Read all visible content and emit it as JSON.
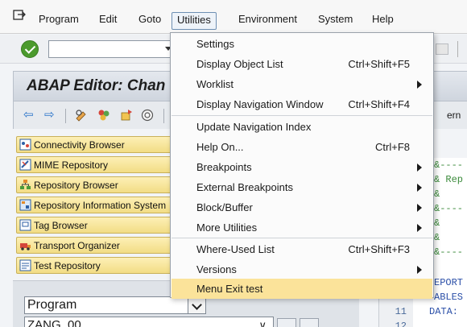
{
  "menubar": {
    "items": [
      {
        "label": "Program"
      },
      {
        "label": "Edit"
      },
      {
        "label": "Goto"
      },
      {
        "label": "Utilities"
      },
      {
        "label": "Environment"
      },
      {
        "label": "System"
      },
      {
        "label": "Help"
      }
    ]
  },
  "title": "ABAP Editor: Chan",
  "pattern_label": "ern",
  "nav": {
    "items": [
      {
        "label": "Connectivity Browser",
        "icon": "connectivity-icon"
      },
      {
        "label": "MIME Repository",
        "icon": "mime-icon"
      },
      {
        "label": "Repository Browser",
        "icon": "repository-icon"
      },
      {
        "label": "Repository Information System",
        "icon": "info-system-icon"
      },
      {
        "label": "Tag Browser",
        "icon": "tag-icon"
      },
      {
        "label": "Transport Organizer",
        "icon": "transport-icon"
      },
      {
        "label": "Test Repository",
        "icon": "test-icon"
      }
    ]
  },
  "object_type": "Program",
  "object_name": "ZANG_00",
  "editor": {
    "lines": [
      {
        "no": "",
        "text": "&----"
      },
      {
        "no": "",
        "text": "& Rep"
      },
      {
        "no": "",
        "text": "&"
      },
      {
        "no": "",
        "text": "&----"
      },
      {
        "no": "",
        "text": "&"
      },
      {
        "no": "",
        "text": "&"
      },
      {
        "no": "",
        "text": "&----"
      },
      {
        "no": "",
        "text": "EPORT"
      },
      {
        "no": "",
        "text": "ABLES"
      },
      {
        "no": "11",
        "text": "DATA: "
      },
      {
        "no": "12",
        "text": ""
      }
    ]
  },
  "dropdown": {
    "items": [
      {
        "label": "Settings",
        "shortcut": "",
        "submenu": false
      },
      {
        "label": "Display Object List",
        "shortcut": "Ctrl+Shift+F5",
        "submenu": false
      },
      {
        "label": "Worklist",
        "shortcut": "",
        "submenu": true
      },
      {
        "label": "Display Navigation Window",
        "shortcut": "Ctrl+Shift+F4",
        "submenu": false
      },
      {
        "label": "Update Navigation Index",
        "shortcut": "",
        "submenu": false
      },
      {
        "label": "Help On...",
        "shortcut": "Ctrl+F8",
        "submenu": false
      },
      {
        "label": "Breakpoints",
        "shortcut": "",
        "submenu": true
      },
      {
        "label": "External Breakpoints",
        "shortcut": "",
        "submenu": true
      },
      {
        "label": "Block/Buffer",
        "shortcut": "",
        "submenu": true
      },
      {
        "label": "More Utilities",
        "shortcut": "",
        "submenu": true
      },
      {
        "label": "Where-Used List",
        "shortcut": "Ctrl+Shift+F3",
        "submenu": false
      },
      {
        "label": "Versions",
        "shortcut": "",
        "submenu": true
      },
      {
        "label": "Menu Exit test",
        "shortcut": "",
        "submenu": false
      }
    ],
    "highlighted": "Menu Exit test"
  },
  "colors": {
    "highlight": "#fbe39a",
    "nav_button": "#f6e29a",
    "menu_active_border": "#6d8fb3"
  }
}
